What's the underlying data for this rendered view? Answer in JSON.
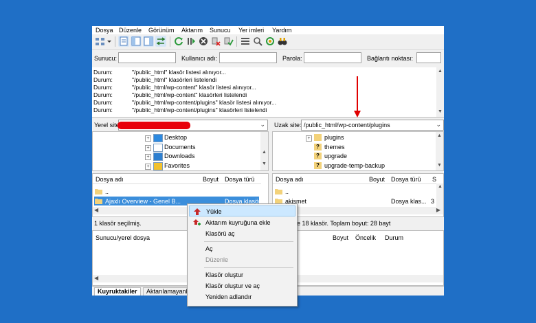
{
  "menu": [
    "Dosya",
    "Düzenle",
    "Görünüm",
    "Aktarım",
    "Sunucu",
    "Yer imleri",
    "Yardım"
  ],
  "quickconnect": {
    "host_label": "Sunucu:",
    "user_label": "Kullanıcı adı:",
    "pass_label": "Parola:",
    "port_label": "Bağlantı noktası:",
    "host_value": "",
    "user_value": "",
    "pass_value": "",
    "port_value": ""
  },
  "log": [
    {
      "k": "Durum:",
      "v": "\"/public_html\" klasör listesi alınıyor..."
    },
    {
      "k": "Durum:",
      "v": "\"/public_html\" klasörleri listelendi"
    },
    {
      "k": "Durum:",
      "v": "\"/public_html/wp-content\" klasör listesi alınıyor..."
    },
    {
      "k": "Durum:",
      "v": "\"/public_html/wp-content\" klasörleri listelendi"
    },
    {
      "k": "Durum:",
      "v": "\"/public_html/wp-content/plugins\" klasör listesi alınıyor..."
    },
    {
      "k": "Durum:",
      "v": "\"/public_html/wp-content/plugins\" klasörleri listelendi"
    }
  ],
  "local": {
    "site_label": "Yerel site:",
    "tree": [
      "Desktop",
      "Documents",
      "Downloads",
      "Favorites"
    ],
    "headers": {
      "name": "Dosya adı",
      "size": "Boyut",
      "type": "Dosya türü"
    },
    "rows": [
      {
        "name": "..",
        "type": ""
      },
      {
        "name": "Ajaxlı Overview - Genel B...",
        "type": "Dosya klasör"
      }
    ],
    "status": "1 klasör seçilmiş."
  },
  "remote": {
    "site_label": "Uzak site:",
    "path": "/public_html/wp-content/plugins",
    "tree": [
      "plugins",
      "themes",
      "upgrade",
      "upgrade-temp-backup"
    ],
    "headers": {
      "name": "Dosya adı",
      "size": "Boyut",
      "type": "Dosya türü",
      "extra": "S"
    },
    "rows": [
      {
        "name": "..",
        "type": "",
        "extra": ""
      },
      {
        "name": "akismet",
        "type": "Dosya klas...",
        "extra": "3"
      }
    ],
    "status": "e 18 klasör. Toplam boyut: 28 bayt"
  },
  "queue": {
    "headers": {
      "file": "Sunucu/yerel dosya",
      "size": "Boyut",
      "priority": "Öncelik",
      "status": "Durum"
    }
  },
  "context_menu": {
    "items": [
      "Yükle",
      "Aktarım kuyruğuna ekle",
      "Klasörü aç",
      "Aç",
      "Düzenle",
      "Klasör oluştur",
      "Klasör oluştur ve aç",
      "Yeniden adlandır"
    ]
  },
  "tabs": [
    "Kuyruktakiler",
    "Aktarılamayanl"
  ],
  "colors": {
    "desktop_bg": "#1f6fc6",
    "selection": "#cce8ff",
    "redaction": "#e8000b",
    "annotation": "#e00000"
  }
}
